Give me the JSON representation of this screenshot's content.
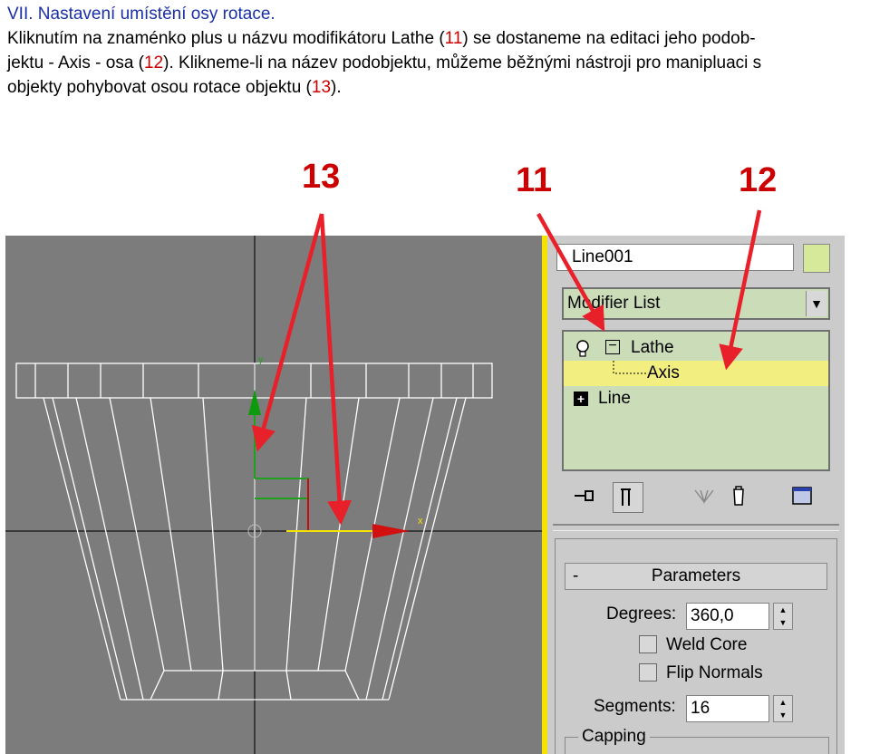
{
  "heading": "VII. Nastavení umístění osy rotace.",
  "body": {
    "l1": "Kliknutím na znaménko plus u názvu modifikátoru Lathe (",
    "r1": "11",
    "l2": ") se dostaneme na editaci jeho podob-",
    "l3": "jektu - Axis - osa (",
    "r2": "12",
    "l4": "). Klikneme-li na název podobjektu, můžeme běžnými nástroji pro manipluaci s",
    "l5": "objekty pohybovat osou rotace objektu (",
    "r3": "13",
    "l6": ")."
  },
  "callouts": {
    "c13": "13",
    "c11": "11",
    "c12": "12"
  },
  "colors": {
    "accent_red": "#e8202a",
    "heading_blue": "#1a2fa8",
    "selection_yellow": "#f3ee80"
  },
  "panel": {
    "object_name": "Line001",
    "modifier_list": "Modifier List",
    "stack": {
      "lathe": {
        "expander": "−",
        "label": "Lathe"
      },
      "axis": {
        "label": "Axis"
      },
      "line": {
        "expander": "+",
        "label": "Line"
      }
    },
    "toolbar_icons": [
      "pin-stack-icon",
      "show-end-result-icon",
      "make-unique-icon",
      "remove-modifier-icon",
      "configure-sets-icon"
    ],
    "rollout_toggle": "-",
    "rollout_title": "Parameters",
    "degrees_label": "Degrees:",
    "degrees_value": "360,0",
    "weld_core_label": "Weld Core",
    "flip_normals_label": "Flip Normals",
    "segments_label": "Segments:",
    "segments_value": "16",
    "capping_label": "Capping"
  },
  "viewport": {
    "gizmo_y": "y",
    "gizmo_x": "x"
  }
}
